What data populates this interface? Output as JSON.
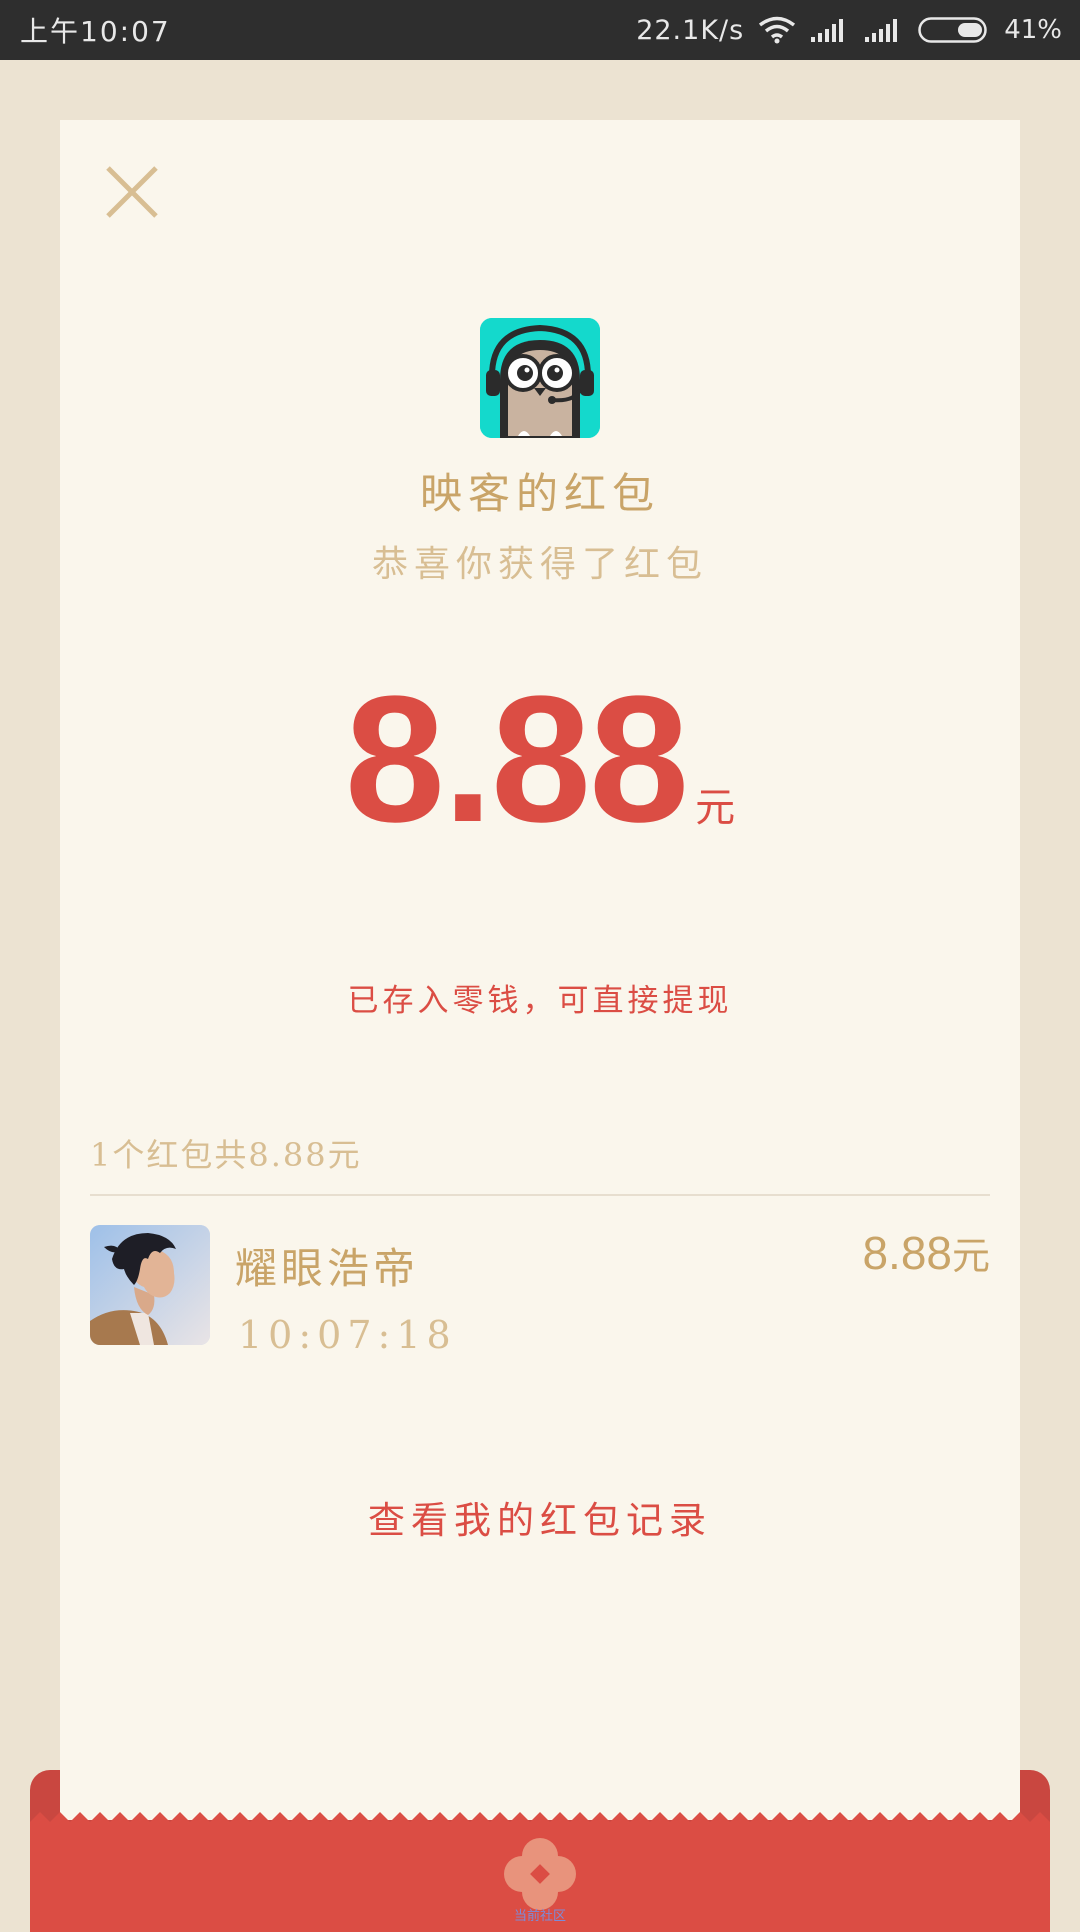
{
  "status_bar": {
    "time": "上午10:07",
    "network_speed": "22.1K/s",
    "battery_percent": "41%",
    "icons": [
      "wifi-icon",
      "signal-icon",
      "signal-icon",
      "battery-icon"
    ]
  },
  "card": {
    "close_icon": "close-icon",
    "app_icon": "owl-app-icon",
    "sender_title": "映客的红包",
    "sender_subtitle": "恭喜你获得了红包",
    "amount": "8.88",
    "amount_unit": "元",
    "amount_note": "已存入零钱，可直接提现",
    "summary": "1个红包共8.88元",
    "receiver": {
      "name": "耀眼浩帝",
      "time": "10:07:18",
      "amount": "8.88",
      "amount_unit": "元"
    },
    "history_link": "查看我的红包记录"
  },
  "envelope": {
    "caption": "当前社区"
  },
  "colors": {
    "background": "#ECE3D2",
    "card": "#FAF6EC",
    "accent_red": "#DB4D44",
    "gold": "#C9A468",
    "gold_light": "#D8BE93",
    "app_icon_bg": "#14D9CC"
  }
}
